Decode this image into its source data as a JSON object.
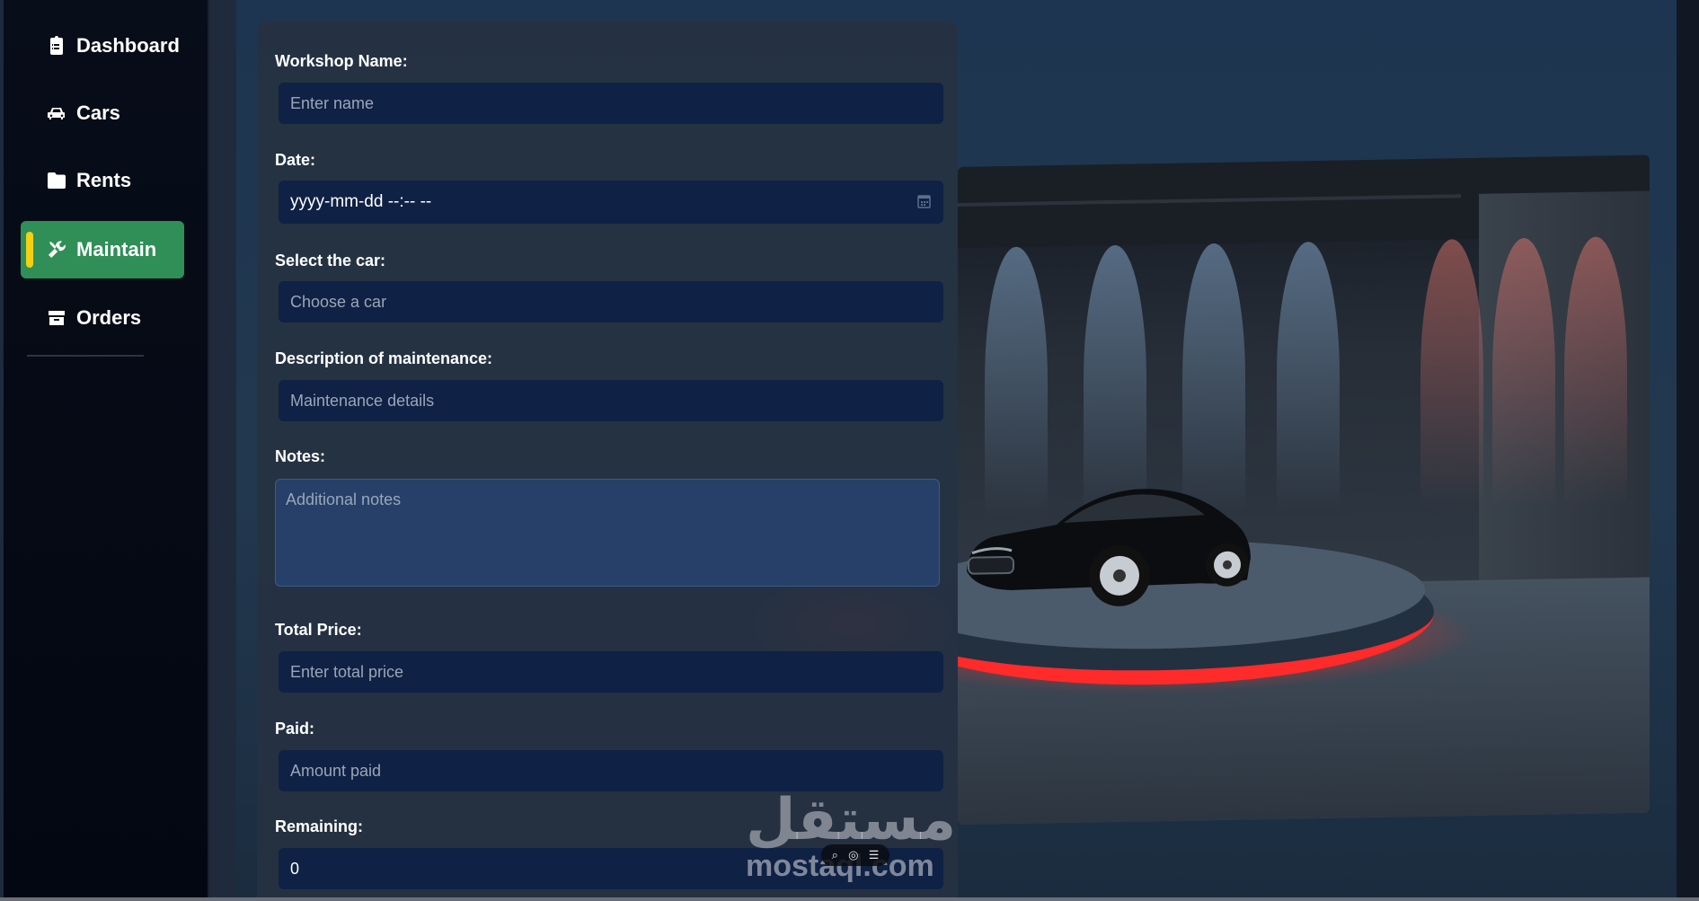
{
  "sidebar": {
    "items": [
      {
        "label": "Dashboard",
        "icon": "clipboard-icon",
        "active": false
      },
      {
        "label": "Cars",
        "icon": "car-icon",
        "active": false
      },
      {
        "label": "Rents",
        "icon": "folder-icon",
        "active": false
      },
      {
        "label": "Maintain",
        "icon": "tools-icon",
        "active": true
      },
      {
        "label": "Orders",
        "icon": "box-icon",
        "active": false
      }
    ]
  },
  "form": {
    "workshop_name": {
      "label": "Workshop Name:",
      "placeholder": "Enter name"
    },
    "date": {
      "label": "Date:",
      "value": "yyyy-mm-dd --:-- --"
    },
    "car": {
      "label": "Select the car:",
      "placeholder": "Choose a car"
    },
    "description": {
      "label": "Description of maintenance:",
      "placeholder": "Maintenance details"
    },
    "notes": {
      "label": "Notes:",
      "placeholder": "Additional notes"
    },
    "total_price": {
      "label": "Total Price:",
      "placeholder": "Enter total price"
    },
    "paid": {
      "label": "Paid:",
      "placeholder": "Amount paid"
    },
    "remaining": {
      "label": "Remaining:",
      "value": "0"
    }
  },
  "watermark": {
    "arabic": "مستقل",
    "latin": "mostaql.com"
  },
  "colors": {
    "accent_active": "#2f8f56",
    "active_marker": "#f4d012",
    "input_bg": "#0f2144"
  }
}
